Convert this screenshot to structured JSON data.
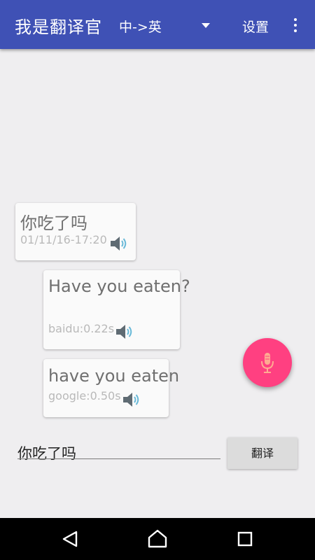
{
  "app_bar": {
    "title": "我是翻译官",
    "language_pair": "中->英",
    "settings_label": "设置"
  },
  "conversation": {
    "source_message": {
      "text": "你吃了吗",
      "timestamp": "01/11/16-17:20"
    },
    "translations": [
      {
        "text": "Have you eaten?",
        "meta": "baidu:0.22s"
      },
      {
        "text": "have you eaten",
        "meta": "google:0.50s"
      }
    ]
  },
  "input": {
    "value": "你吃了吗",
    "translate_label": "翻译"
  },
  "colors": {
    "app_bar": "#3f51b5",
    "fab": "#ff4081",
    "background": "#efeef0"
  },
  "icons": [
    "overflow-menu-icon",
    "speaker-icon",
    "microphone-icon",
    "back-icon",
    "home-icon",
    "recents-icon"
  ]
}
